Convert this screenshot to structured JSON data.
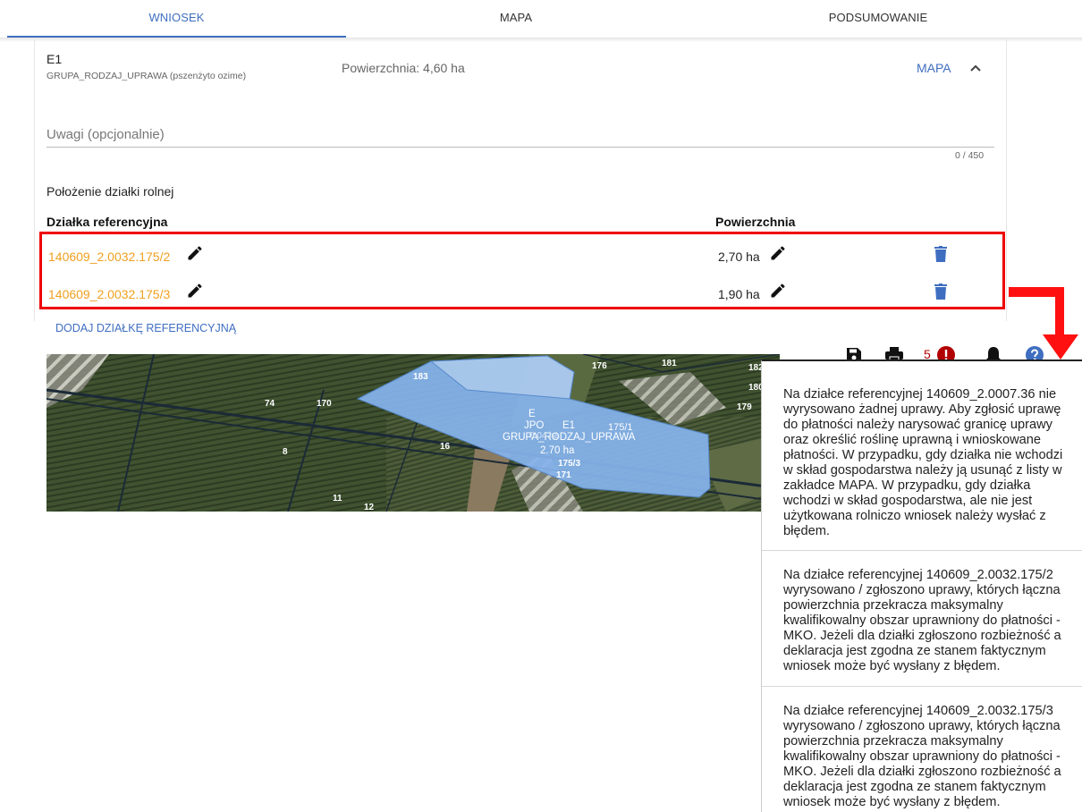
{
  "tabs": [
    {
      "label": "WNIOSEK"
    },
    {
      "label": "MAPA"
    },
    {
      "label": "PODSUMOWANIE"
    }
  ],
  "crop": {
    "code": "E1",
    "subtitle": "GRUPA_RODZAJ_UPRAWA (pszenżyto ozime)",
    "area": "Powierzchnia: 4,60 ha",
    "map_link": "MAPA"
  },
  "remarks": {
    "placeholder": "Uwagi (opcjonalnie)",
    "counter": "0 / 450"
  },
  "location": {
    "title": "Położenie działki rolnej",
    "col_parcel": "Działka referencyjna",
    "col_area": "Powierzchnia",
    "rows": [
      {
        "parcel": "140609_2.0032.175/2",
        "area": "2,70 ha"
      },
      {
        "parcel": "140609_2.0032.175/3",
        "area": "1,90 ha"
      }
    ],
    "add_button": "DODAJ DZIAŁKĘ REFERENCYJNĄ"
  },
  "map": {
    "labels": [
      {
        "text": "183"
      },
      {
        "text": "176"
      },
      {
        "text": "181"
      },
      {
        "text": "182"
      },
      {
        "text": "180"
      },
      {
        "text": "179"
      },
      {
        "text": "74"
      },
      {
        "text": "170"
      },
      {
        "text": "8"
      },
      {
        "text": "16"
      },
      {
        "text": "11"
      },
      {
        "text": "12"
      },
      {
        "text": "171"
      },
      {
        "text": "175/3"
      }
    ],
    "crop_labels": {
      "line1": "E",
      "line2": "JPO",
      "line3": "E1",
      "line4": "GRUPA_RODZAJ_UPRAWA",
      "line5": "2.70 ha",
      "line6": "175/1",
      "line7": "0.04 ha"
    }
  },
  "toolbar": {
    "error_count": "5"
  },
  "notifications": [
    {
      "text": "Na działce referencyjnej 140609_2.0007.36 nie wyrysowano żadnej uprawy. Aby zgłosić uprawę do płatności należy narysować granicę uprawy oraz określić roślinę uprawną i wnioskowane płatności. W przypadku, gdy działka nie wchodzi w skład gospodarstwa należy ją usunąć z listy w zakładce MAPA. W przypadku, gdy działka wchodzi w skład gospodarstwa, ale nie jest użytkowana rolniczo wniosek należy wysłać z błędem."
    },
    {
      "text": "Na działce referencyjnej 140609_2.0032.175/2 wyrysowano / zgłoszono uprawy, których łączna powierzchnia przekracza maksymalny kwalifikowalny obszar uprawniony do płatności - MKO. Jeżeli dla działki zgłoszono rozbieżność a deklaracja jest zgodna ze stanem faktycznym wniosek może być wysłany z błędem."
    },
    {
      "text": "Na działce referencyjnej 140609_2.0032.175/3 wyrysowano / zgłoszono uprawy, których łączna powierzchnia przekracza maksymalny kwalifikowalny obszar uprawniony do płatności - MKO. Jeżeli dla działki zgłoszono rozbieżność a deklaracja jest zgodna ze stanem faktycznym wniosek może być wysłany z błędem."
    }
  ],
  "colors": {
    "accent": "#3f6ec0",
    "parcel_link": "#f0a020",
    "highlight": "#e00000",
    "error": "#b00000"
  }
}
